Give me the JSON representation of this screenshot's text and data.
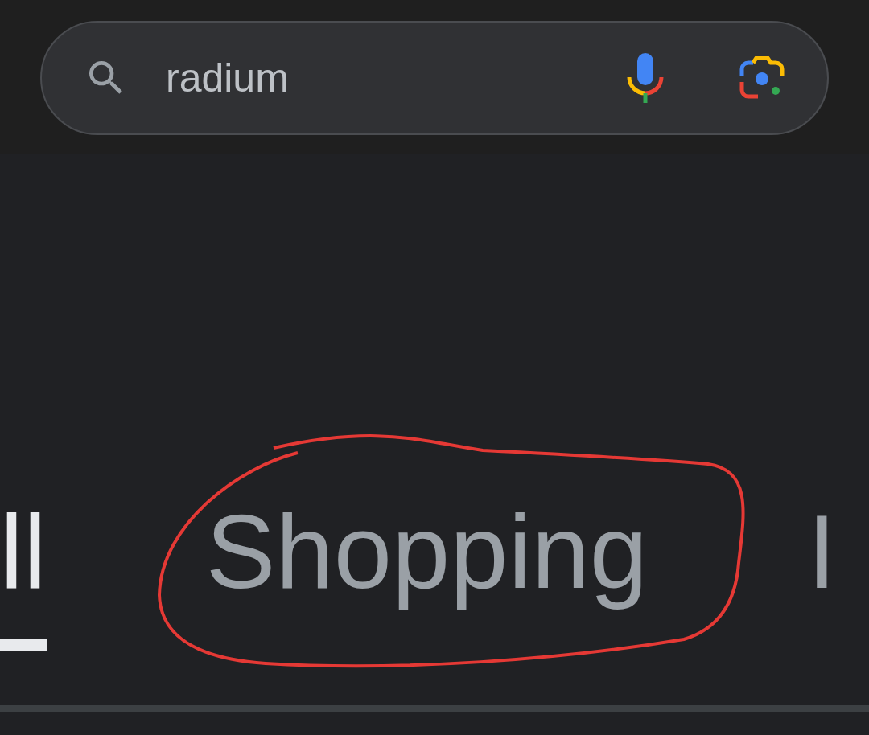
{
  "search": {
    "value": "radium"
  },
  "tabs": [
    {
      "label": "ll",
      "selected": true
    },
    {
      "label": "Shopping",
      "selected": false
    },
    {
      "label": "I",
      "selected": false
    }
  ]
}
